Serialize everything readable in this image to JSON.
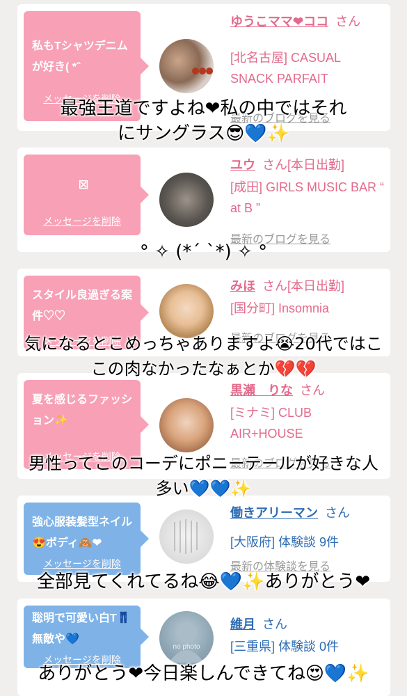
{
  "delete_label": "メッセージを削除",
  "colors": {
    "pink": "#f7a0b6",
    "blue": "#7fb3e8",
    "pink_text": "#e36a8c",
    "blue_text": "#2e6db4"
  },
  "cards": [
    {
      "message": "私もTシャツデニムが好き( *ˆ",
      "name": "ゆうこママ❤ココ",
      "suffix": "さん",
      "location": "[北名古屋] CASUAL SNACK PARFAIT",
      "link": "最新のブログを見る"
    },
    {
      "message": "☒",
      "name": "ユウ",
      "suffix": "さん[本日出勤]",
      "location": "[成田] GIRLS MUSIC BAR “ at B ”",
      "link": "最新のブログを見る"
    },
    {
      "message": "スタイル良過ぎる案件♡♡",
      "name": "みほ",
      "suffix": "さん[本日出勤]",
      "location": "[国分町] Insomnia",
      "link": "最新のブログを見る"
    },
    {
      "message": "夏を感じるファッション✨",
      "name": "黒瀬　りな",
      "suffix": "さん",
      "location": "[ミナミ] CLUB AIR+HOUSE",
      "link": "最新のブログを見る"
    },
    {
      "message": "強心服装髪型ネイル😍ボディ🙈❤",
      "name": "働きアリーマン",
      "suffix": "さん",
      "location": "[大阪府] 体験談 9件",
      "link": "最新の体験談を見る"
    },
    {
      "message": "聡明で可愛い白T👖無敵や💙",
      "name": "維月",
      "suffix": "さん",
      "location": "[三重県] 体験談 0件",
      "avatar_text": "no photo"
    }
  ],
  "overlays": [
    {
      "line1": "最強王道ですよね❤私の中ではそれ",
      "line2": "にサングラス😎💙✨"
    },
    {
      "line1": "° ✧ (*´ `*) ✧ °"
    },
    {
      "line1": "気になるとこめっちゃありますよ😭20代ではこ",
      "line2": "この肉なかったなぁとか💔💔"
    },
    {
      "line1": "男性ってこのコーデにポニーテールが好きな人",
      "line2": "多い💙💙✨"
    },
    {
      "line1": "全部見てくれてるね😂💙✨ありがとう❤"
    },
    {
      "line1": "ありがとう❤今日楽しんできてね😍💙✨"
    }
  ]
}
